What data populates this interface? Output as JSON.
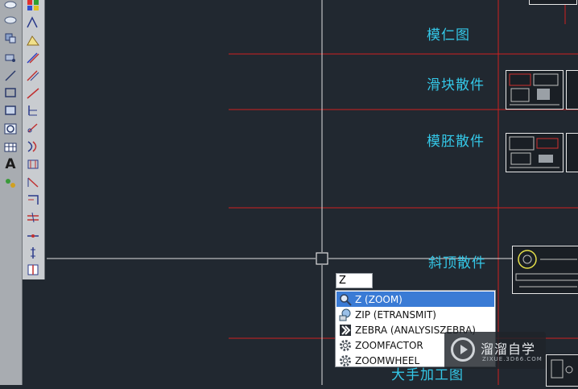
{
  "drawing": {
    "labels": [
      "模仁图",
      "滑块散件",
      "模胚散件",
      "斜顶散件",
      "大手加工图"
    ]
  },
  "command": {
    "input_value": "Z"
  },
  "autocomplete": {
    "items": [
      {
        "label": "Z (ZOOM)",
        "icon": "zoom-magnifier-icon",
        "selected": true
      },
      {
        "label": "ZIP (ETRANSMIT)",
        "icon": "etransmit-icon",
        "selected": false
      },
      {
        "label": "ZEBRA (ANALYSISZEBRA)",
        "icon": "zebra-icon",
        "selected": false
      },
      {
        "label": "ZOOMFACTOR",
        "icon": "gear-icon",
        "selected": false
      },
      {
        "label": "ZOOMWHEEL",
        "icon": "gear-icon",
        "selected": false
      }
    ]
  },
  "watermark": {
    "title": "溜溜自学",
    "subtitle": "ZIXUE.3D66.COM"
  },
  "colors": {
    "canvas": "#212830",
    "redline": "#d02020",
    "crosshair": "#e0e0e0",
    "label": "#34c8e8",
    "selected": "#3a7bd5"
  }
}
